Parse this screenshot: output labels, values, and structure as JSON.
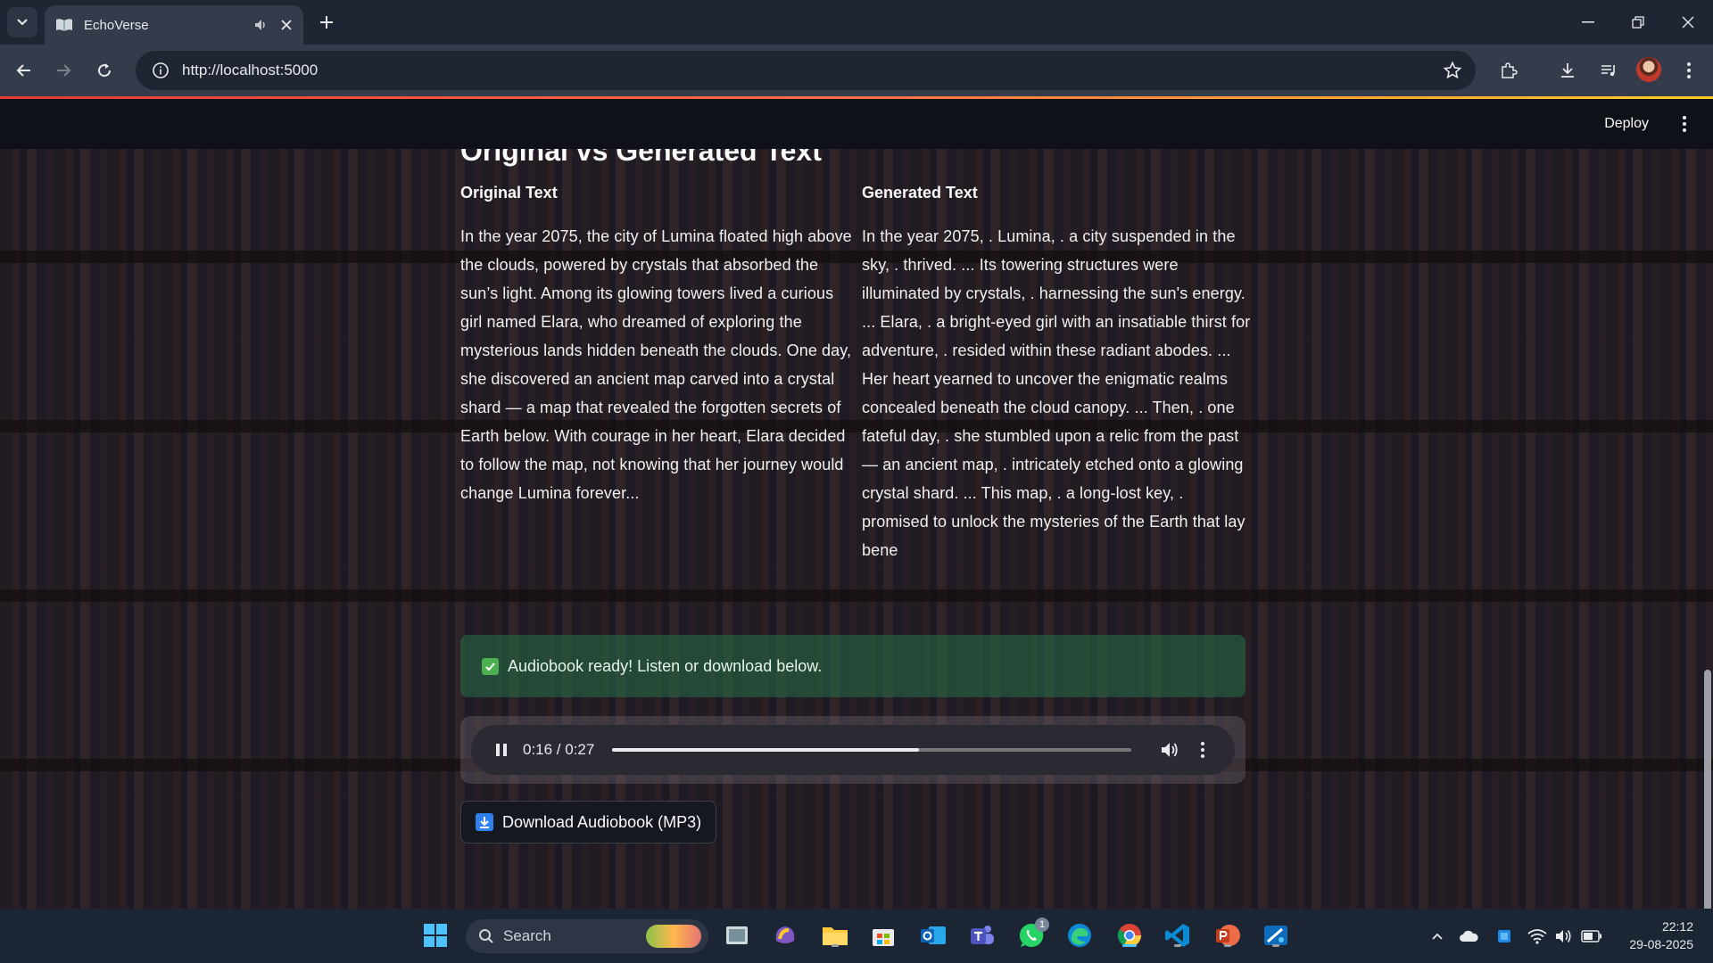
{
  "browser": {
    "tab_title": "EchoVerse",
    "url": "http://localhost:5000"
  },
  "app": {
    "deploy_label": "Deploy",
    "section_title": "Original vs Generated Text",
    "original": {
      "heading": "Original Text",
      "body": "In the year 2075, the city of Lumina floated high above the clouds, powered by crystals that absorbed the sun’s light. Among its glowing towers lived a curious girl named Elara, who dreamed of exploring the mysterious lands hidden beneath the clouds. One day, she discovered an ancient map carved into a crystal shard — a map that revealed the forgotten secrets of Earth below. With courage in her heart, Elara decided to follow the map, not knowing that her journey would change Lumina forever..."
    },
    "generated": {
      "heading": "Generated Text",
      "body": "In the year 2075, . Lumina, . a city suspended in the sky, . thrived. ... Its towering structures were illuminated by crystals, . harnessing the sun's energy. ... Elara, . a bright-eyed girl with an insatiable thirst for adventure, . resided within these radiant abodes. ... Her heart yearned to uncover the enigmatic realms concealed beneath the cloud canopy. ... Then, . one fateful day, . she stumbled upon a relic from the past — an ancient map, . intricately etched onto a glowing crystal shard. ... This map, . a long-lost key, . promised to unlock the mysteries of the Earth that lay bene"
    },
    "success_message": "Audiobook ready! Listen or download below.",
    "player": {
      "time": "0:16 / 0:27",
      "progress": 0.59
    },
    "download_label": "Download Audiobook (MP3)"
  },
  "taskbar": {
    "search_label": "Search",
    "whatsapp_badge": "1",
    "time": "22:12",
    "date": "29-08-2025"
  },
  "colors": {
    "success_bg": "#277048",
    "accent_loadbar": "#ff7043",
    "download_icon": "#2f80ed"
  }
}
